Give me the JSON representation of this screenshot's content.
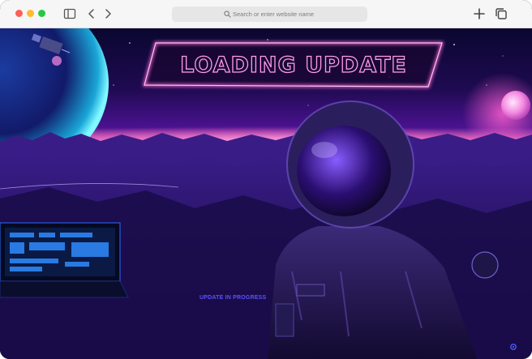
{
  "browser": {
    "address_bar": {
      "placeholder": "Search or enter website name",
      "icon": "search-icon"
    },
    "toolbar_icons": [
      "sidebar-icon",
      "back-arrow-icon",
      "forward-arrow-icon",
      "new-tab-plus-icon",
      "tabs-overview-icon"
    ],
    "traffic_lights": {
      "close": "#fe5f57",
      "minimize": "#febc2e",
      "zoom": "#28c840"
    }
  },
  "page": {
    "headline": "LOADING UPDATE",
    "status_text": "UPDATE IN PROGRESS",
    "accent_colors": {
      "neon_pink": "#ff6ad5",
      "cyan_glow": "#00e5ff",
      "purple": "#7a2bff",
      "status_blue": "#5a52ff"
    }
  }
}
